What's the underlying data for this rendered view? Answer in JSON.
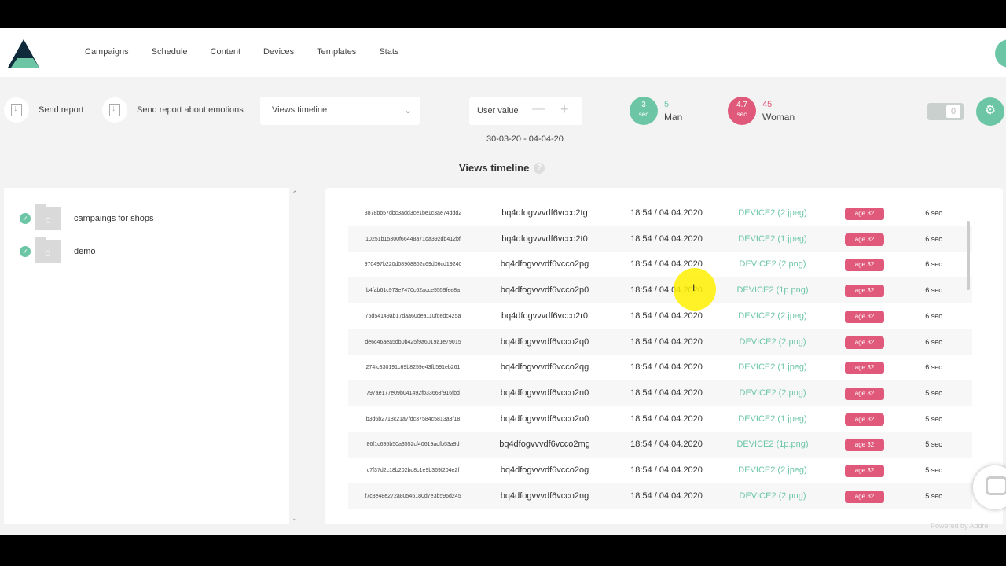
{
  "nav": {
    "items": [
      "Campaigns",
      "Schedule",
      "Content",
      "Devices",
      "Templates",
      "Stats"
    ]
  },
  "toolbar": {
    "send_report": "Send report",
    "send_report_emotions": "Send report about emotions",
    "views_select": "Views timeline",
    "user_value_label": "User value",
    "minus": "—",
    "plus": "+",
    "date_range": "30-03-20 - 04-04-20",
    "toggle_value": "0"
  },
  "stats": {
    "man": {
      "time": "3",
      "unit": "sec",
      "count": "5",
      "label": "Man",
      "color": "#6cc6a6"
    },
    "woman": {
      "time": "4.7",
      "unit": "sec",
      "count": "45",
      "label": "Woman",
      "color": "#e0587a"
    }
  },
  "section_title": "Views timeline",
  "help_icon": "?",
  "folders": [
    {
      "letter": "c",
      "label": "campaings for shops"
    },
    {
      "letter": "d",
      "label": "demo"
    }
  ],
  "rows": [
    {
      "hash": "3878bb57dbc3add3ce1be1c3ae74ddd2",
      "code": "bq4dfogvvvdf6vcco2tg",
      "time": "18:54 / 04.04.2020",
      "device": "DEVICE2 (2.jpeg)",
      "age": "age 32",
      "dur": "6 sec"
    },
    {
      "hash": "10251b15300f66448a71da392db412bf",
      "code": "bq4dfogvvvdf6vcco2t0",
      "time": "18:54 / 04.04.2020",
      "device": "DEVICE2 (1.jpeg)",
      "age": "age 32",
      "dur": "6 sec"
    },
    {
      "hash": "970497b220d08908862c69d06cd19240",
      "code": "bq4dfogvvvdf6vcco2pg",
      "time": "18:54 / 04.04.2020",
      "device": "DEVICE2 (2.png)",
      "age": "age 32",
      "dur": "6 sec"
    },
    {
      "hash": "b4fab61c973e7470c62acce5559fee8a",
      "code": "bq4dfogvvvdf6vcco2p0",
      "time": "18:54 / 04.04.2020",
      "device": "DEVICE2 (1p.png)",
      "age": "age 32",
      "dur": "6 sec"
    },
    {
      "hash": "75d54149ab17daa60dea110fdedc425a",
      "code": "bq4dfogvvvdf6vcco2r0",
      "time": "18:54 / 04.04.2020",
      "device": "DEVICE2 (2.jpeg)",
      "age": "age 32",
      "dur": "6 sec"
    },
    {
      "hash": "de6c46aea5db0b425f9a6019a1e79015",
      "code": "bq4dfogvvvdf6vcco2q0",
      "time": "18:54 / 04.04.2020",
      "device": "DEVICE2 (2.png)",
      "age": "age 32",
      "dur": "6 sec"
    },
    {
      "hash": "274fc330191c69b8259e43fb591eb261",
      "code": "bq4dfogvvvdf6vcco2qg",
      "time": "18:54 / 04.04.2020",
      "device": "DEVICE2 (1.jpeg)",
      "age": "age 32",
      "dur": "6 sec"
    },
    {
      "hash": "797ae177e09b041492fb33663f916fbd",
      "code": "bq4dfogvvvdf6vcco2n0",
      "time": "18:54 / 04.04.2020",
      "device": "DEVICE2 (2.png)",
      "age": "age 32",
      "dur": "5 sec"
    },
    {
      "hash": "b3d6b2718c21a7fdc37584c5813a3f18",
      "code": "bq4dfogvvvdf6vcco2o0",
      "time": "18:54 / 04.04.2020",
      "device": "DEVICE2 (1.jpeg)",
      "age": "age 32",
      "dur": "5 sec"
    },
    {
      "hash": "86f1c695b50a3552cf40619adfb53a9d",
      "code": "bq4dfogvvvdf6vcco2mg",
      "time": "18:54 / 04.04.2020",
      "device": "DEVICE2 (1p.png)",
      "age": "age 32",
      "dur": "5 sec"
    },
    {
      "hash": "c7f37d2c18b202bd8c1e9b369f204e2f",
      "code": "bq4dfogvvvdf6vcco2og",
      "time": "18:54 / 04.04.2020",
      "device": "DEVICE2 (2.jpeg)",
      "age": "age 32",
      "dur": "5 sec"
    },
    {
      "hash": "f7c3e48e272a80546180d7e3b596d245",
      "code": "bq4dfogvvvdf6vcco2ng",
      "time": "18:54 / 04.04.2020",
      "device": "DEVICE2 (2.png)",
      "age": "age 32",
      "dur": "5 sec"
    }
  ],
  "footer": {
    "powered": "Powered by Addre"
  }
}
